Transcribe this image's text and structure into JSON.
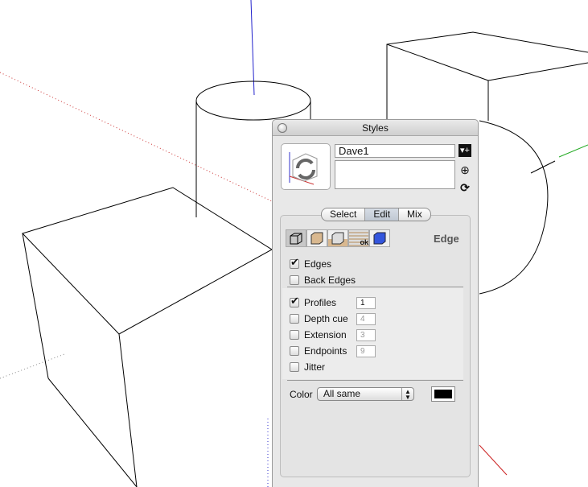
{
  "panel": {
    "title": "Styles",
    "style_name": "Dave1",
    "style_description": "",
    "tabs": [
      {
        "label": "Select"
      },
      {
        "label": "Edit",
        "active": true
      },
      {
        "label": "Mix"
      }
    ],
    "section_icons": [
      "edge-settings-icon",
      "face-settings-icon",
      "background-settings-icon",
      "watermark-settings-icon",
      "modeling-settings-icon"
    ],
    "section_title": "Edge",
    "edges": {
      "label": "Edges",
      "checked": true
    },
    "back_edges": {
      "label": "Back Edges",
      "checked": false
    },
    "options": [
      {
        "label": "Profiles",
        "checked": true,
        "value": "1"
      },
      {
        "label": "Depth cue",
        "checked": false,
        "value": "4"
      },
      {
        "label": "Extension",
        "checked": false,
        "value": "3"
      },
      {
        "label": "Endpoints",
        "checked": false,
        "value": "9"
      }
    ],
    "jitter": {
      "label": "Jitter",
      "checked": false
    },
    "color_label": "Color",
    "color_select": "All same",
    "edge_color": "#000000"
  }
}
